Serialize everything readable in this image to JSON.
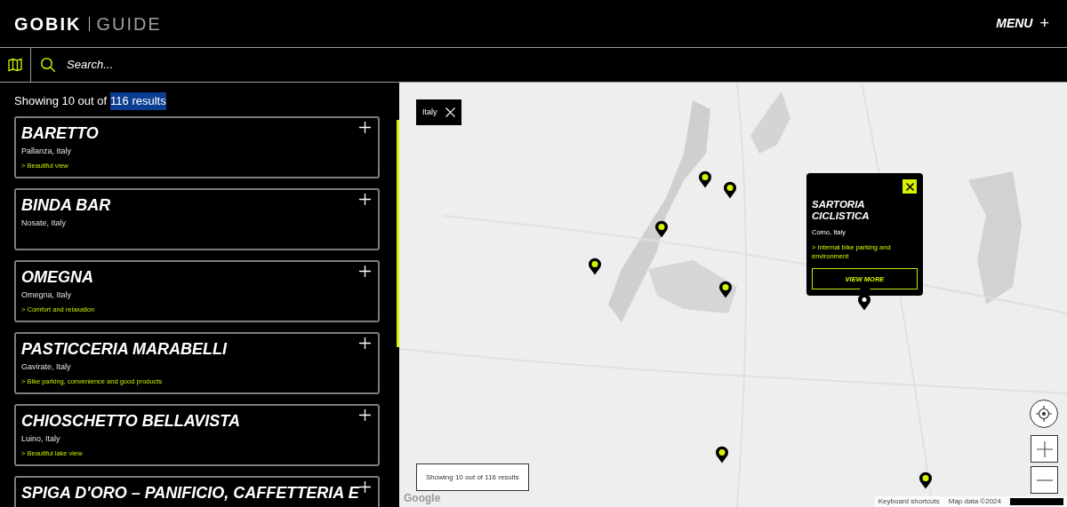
{
  "header": {
    "logo_brand": "GOBIK",
    "logo_product": "GUIDE",
    "menu_label": "MENU",
    "menu_icon": "+"
  },
  "search": {
    "placeholder": "Search..."
  },
  "results": {
    "prefix": "Showing 10 out of",
    "highlighted": "116 results",
    "highlight_selected": true
  },
  "places": [
    {
      "name": "BARETTO",
      "location": "Pallanza, Italy",
      "highlight": "> Beautiful view"
    },
    {
      "name": "BINDA BAR",
      "location": "Nosate, Italy"
    },
    {
      "name": "OMEGNA",
      "location": "Omegna, Italy",
      "highlight": "> Comfort and relaxation"
    },
    {
      "name": "PASTICCERIA MARABELLI",
      "location": "Gavirate, Italy",
      "highlight": "> Bike parking, convenience and good products"
    },
    {
      "name": "CHIOSCHETTO BELLAVISTA",
      "location": "Luino, Italy",
      "highlight": "> Beautiful lake view"
    },
    {
      "name": "SPIGA D'ORO – PANIFICIO, CAFFETTERIA E"
    }
  ],
  "map": {
    "filter_chip": "Italy",
    "pins": [
      {
        "selected": false
      },
      {
        "selected": false
      },
      {
        "selected": false
      },
      {
        "selected": false
      },
      {
        "selected": false
      },
      {
        "selected": true
      },
      {
        "selected": false
      },
      {
        "selected": false
      }
    ],
    "popup": {
      "name": "SARTORIA CICLISTICA",
      "location": "Como, Italy",
      "highlight": "> Internal bike parking and environment",
      "button": "VIEW MORE"
    },
    "results_box": "Showing 10 out of 116 results",
    "attribution": [
      "Google",
      "Keyboard shortcuts",
      "Map data ©2024"
    ]
  }
}
